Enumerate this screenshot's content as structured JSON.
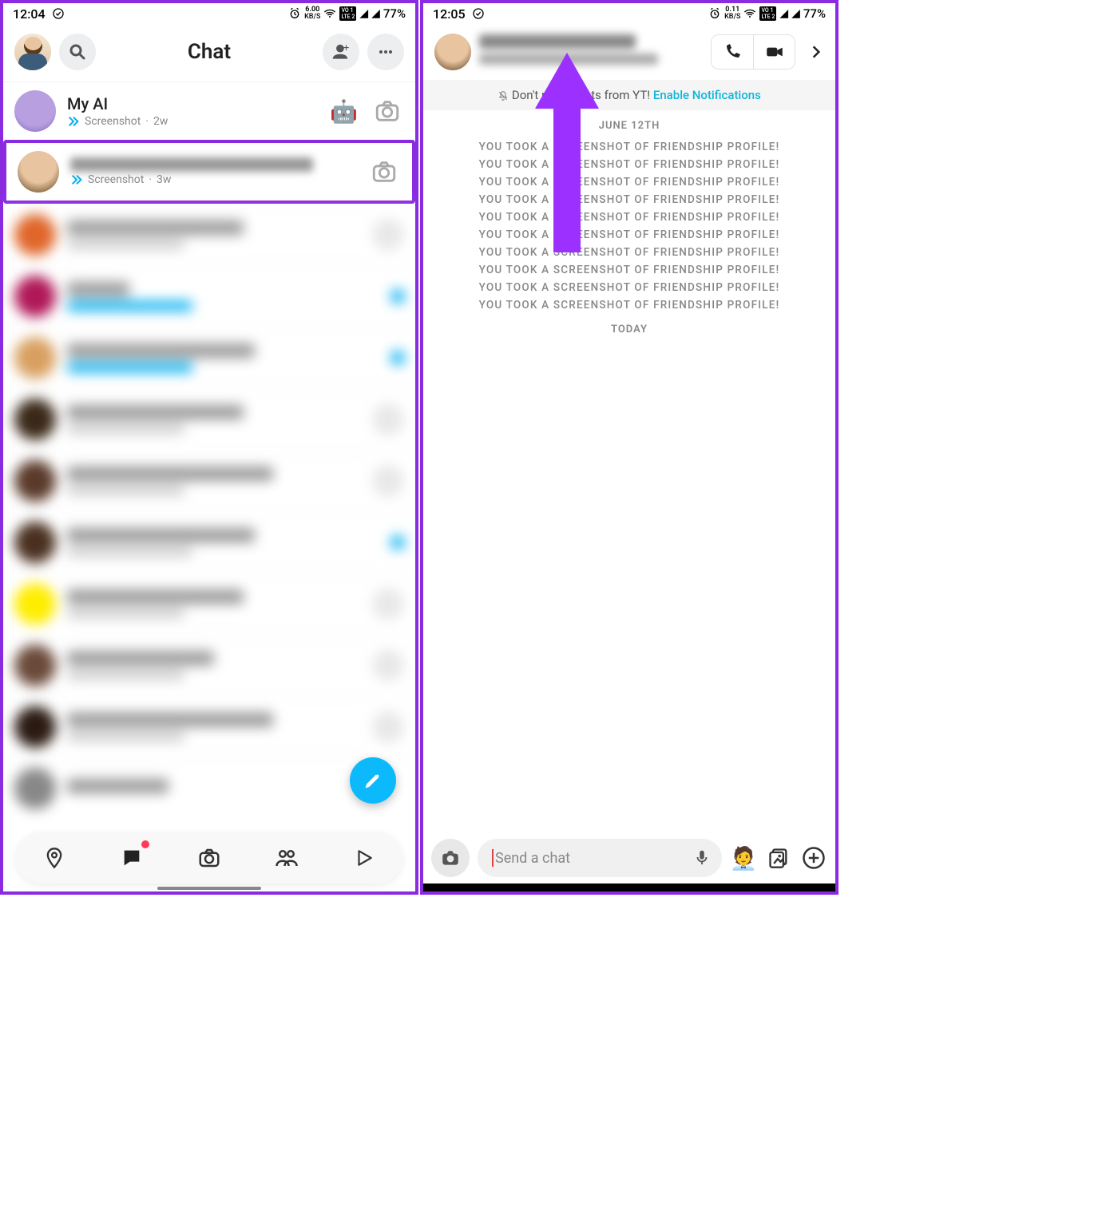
{
  "left": {
    "status": {
      "time": "12:04",
      "speed_top": "6.00",
      "speed_unit": "KB/S",
      "lte1": "VO 1",
      "lte2": "LTE 2",
      "battery": "77%"
    },
    "header": {
      "title": "Chat"
    },
    "rows": [
      {
        "name": "My AI",
        "sub_status": "Screenshot",
        "sub_time": "2w",
        "emoji": "🤖"
      },
      {
        "name": "",
        "sub_status": "Screenshot",
        "sub_time": "3w"
      }
    ]
  },
  "right": {
    "status": {
      "time": "12:05",
      "speed_top": "0.11",
      "speed_unit": "KB/S",
      "lte1": "VO 1",
      "lte2": "LTE 2",
      "battery": "77%"
    },
    "notif_prefix": "Don't miss Chats from YT! ",
    "notif_link": "Enable Notifications",
    "date1": "JUNE 12TH",
    "sys_msg": "YOU TOOK A SCREENSHOT OF FRIENDSHIP PROFILE!",
    "sys_count": 10,
    "date2": "TODAY",
    "input_placeholder": "Send a chat"
  }
}
